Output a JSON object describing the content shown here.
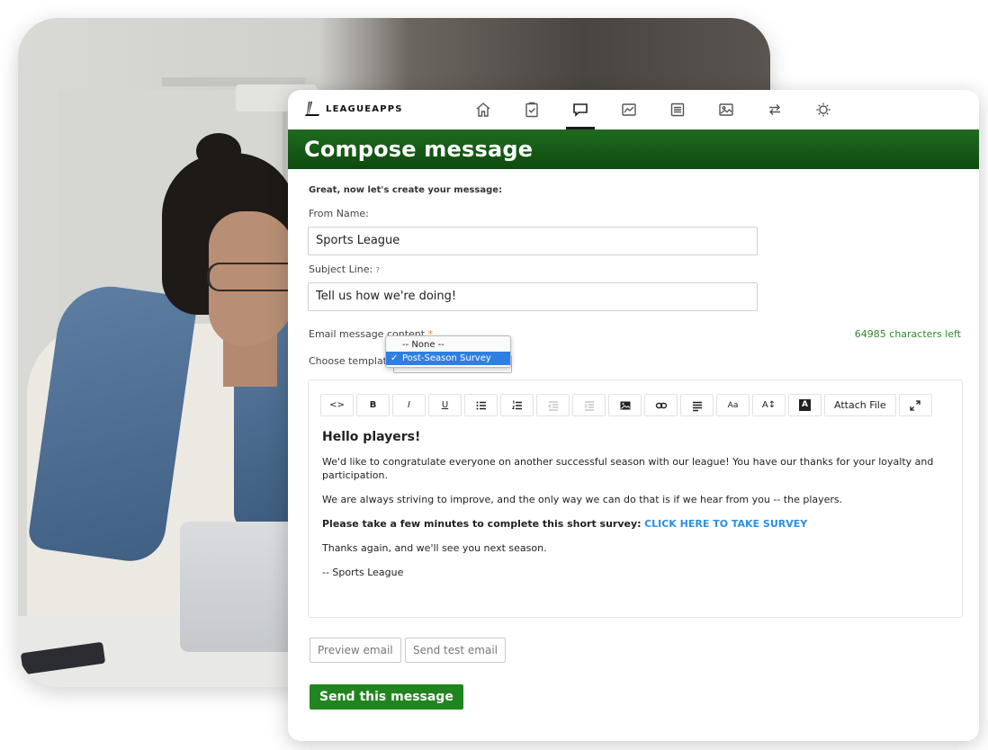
{
  "brand": {
    "logo_text": "LEAGUEAPPS",
    "logo_mark": "L"
  },
  "nav": {
    "items": [
      {
        "icon": "home-icon"
      },
      {
        "icon": "clipboard-check-icon"
      },
      {
        "icon": "message-icon",
        "active": true
      },
      {
        "icon": "chart-icon"
      },
      {
        "icon": "list-icon"
      },
      {
        "icon": "image-icon"
      },
      {
        "icon": "transfer-icon"
      },
      {
        "icon": "settings-icon"
      }
    ]
  },
  "header": {
    "title": "Compose message"
  },
  "form": {
    "intro": "Great, now let's create your message:",
    "from_label": "From Name:",
    "from_value": "Sports League",
    "subject_label": "Subject Line:",
    "subject_help": "?",
    "subject_value": "Tell us how we're doing!",
    "content_label": "Email message content",
    "required_mark": "*",
    "chars_left": "64985 characters left",
    "template_label": "Choose template",
    "template_options": [
      "-- None --",
      "Post-Season Survey"
    ],
    "template_selected": "Post-Season Survey",
    "check_mark": "✓"
  },
  "toolbar": {
    "buttons": [
      {
        "name": "code-view-button",
        "label": "<>"
      },
      {
        "name": "bold-button",
        "label": "B"
      },
      {
        "name": "italic-button",
        "label": "I"
      },
      {
        "name": "underline-button",
        "label": "U"
      },
      {
        "name": "bullet-list-button",
        "icon": "bullet-list-icon"
      },
      {
        "name": "numbered-list-button",
        "icon": "numbered-list-icon"
      },
      {
        "name": "outdent-button",
        "icon": "outdent-icon"
      },
      {
        "name": "indent-button",
        "icon": "indent-icon"
      },
      {
        "name": "insert-image-button",
        "icon": "image-icon"
      },
      {
        "name": "insert-link-button",
        "icon": "link-icon"
      },
      {
        "name": "align-button",
        "icon": "align-left-icon"
      },
      {
        "name": "font-button",
        "label": "Aa"
      },
      {
        "name": "font-size-button",
        "label": "A↕"
      },
      {
        "name": "font-color-button",
        "label": "A"
      },
      {
        "name": "attach-file-button",
        "label": "Attach File"
      },
      {
        "name": "fullscreen-button",
        "icon": "expand-icon"
      }
    ]
  },
  "email": {
    "heading": "Hello players!",
    "p1": "We'd like to congratulate everyone on another successful season with our league! You have our thanks for your loyalty and participation.",
    "p2": "We are always striving to improve, and the only way we can do that is if we hear from you -- the players.",
    "p3_bold": "Please take a few minutes to complete this short survey:",
    "p3_link": "CLICK HERE TO TAKE SURVEY",
    "p4": "Thanks again, and we'll see you next season.",
    "p5": "-- Sports League"
  },
  "actions": {
    "preview": "Preview email",
    "send_test": "Send test email",
    "send": "Send this message"
  },
  "colors": {
    "brand_green": "#21851f",
    "header_green": "#0f4a0f",
    "link_blue": "#2c8fe0",
    "chars_green": "#2d8a2d",
    "required_orange": "#e58a16"
  }
}
